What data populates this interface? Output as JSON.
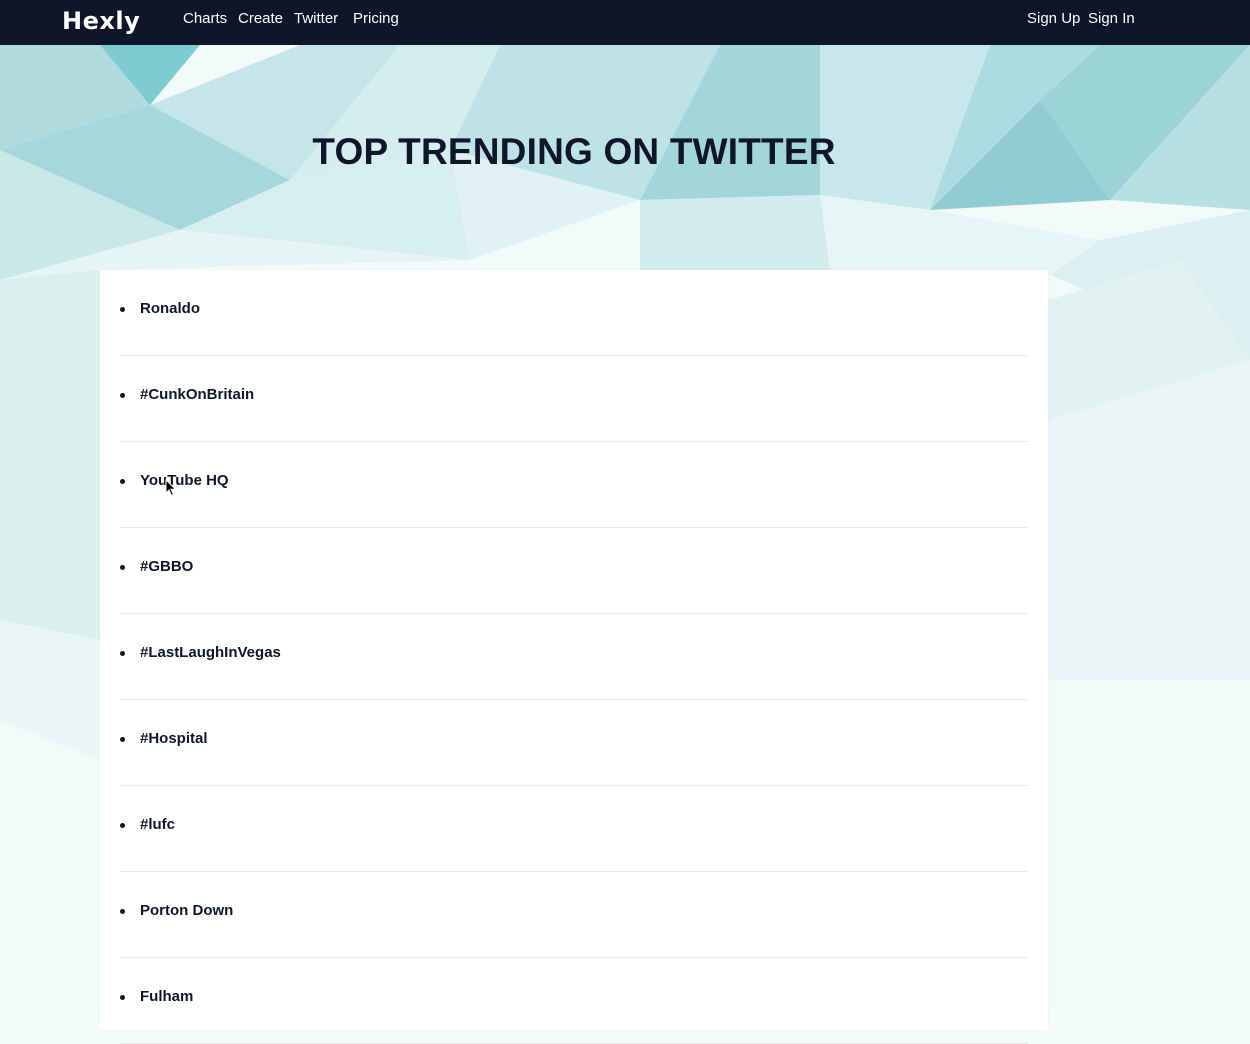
{
  "navbar": {
    "logo": "Hexly",
    "links": [
      "Charts",
      "Create",
      "Twitter",
      "Pricing"
    ],
    "auth": [
      "Sign Up",
      "Sign In"
    ]
  },
  "hero": {
    "title": "TOP TRENDING ON TWITTER"
  },
  "trends": [
    "Ronaldo",
    "#CunkOnBritain",
    "YouTube HQ",
    "#GBBO",
    "#LastLaughInVegas",
    "#Hospital",
    "#lufc",
    "Porton Down",
    "Fulham"
  ],
  "colors": {
    "navbar_bg": "#10162a",
    "text_dark": "#10162a",
    "accent_teal": "#8fd0d3"
  },
  "icons": {
    "cursor": "mouse-pointer-icon"
  }
}
